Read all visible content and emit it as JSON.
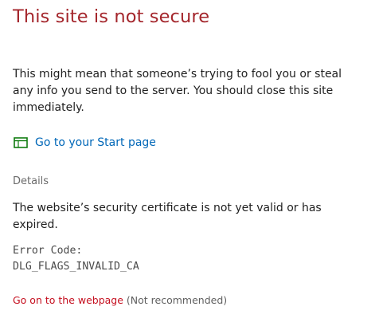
{
  "title": "This site is not secure",
  "warning": "This might mean that someone’s trying to fool you or steal any info you send to the server. You should close this site immediately.",
  "start_link": {
    "label": "Go to your Start page",
    "icon": "start-page-icon"
  },
  "details_label": "Details",
  "certificate_message": "The website’s security certificate is not yet valid or has expired.",
  "error_code": {
    "label": "Error Code:",
    "value": "DLG_FLAGS_INVALID_CA"
  },
  "continue": {
    "link_label": "Go on to the webpage",
    "note": "(Not recommended)"
  },
  "colors": {
    "title": "#a4262c",
    "link": "#0067b8",
    "danger_link": "#c50f1f"
  }
}
